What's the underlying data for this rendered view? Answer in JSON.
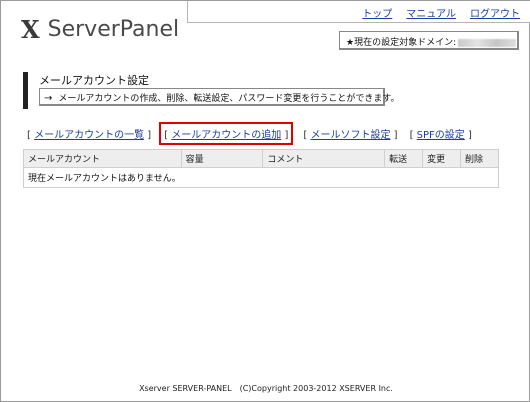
{
  "header": {
    "logo_mark": "X",
    "logo_text": "ServerPanel",
    "nav": [
      "トップ",
      "マニュアル",
      "ログアウト"
    ],
    "target_label": "★現在の設定対象ドメイン:"
  },
  "section": {
    "title": "メールアカウント設定",
    "arrow": "→",
    "description": "メールアカウントの作成、削除、転送設定、パスワード変更を行うことができます。"
  },
  "subnav": {
    "items": [
      {
        "label": "メールアカウントの一覧",
        "highlighted": false
      },
      {
        "label": "メールアカウントの追加",
        "highlighted": true
      },
      {
        "label": "メールソフト設定",
        "highlighted": false
      },
      {
        "label": "SPFの設定",
        "highlighted": false
      }
    ]
  },
  "table": {
    "columns": [
      "メールアカウント",
      "容量",
      "コメント",
      "転送",
      "変更",
      "削除"
    ],
    "empty_message": "現在メールアカウントはありません。"
  },
  "footer": {
    "text": "Xserver SERVER-PANEL　(C)Copyright 2003-2012 XSERVER Inc."
  },
  "colors": {
    "link": "#1a3fa0",
    "highlight_border": "#e00000",
    "table_header_bg": "#eeeeee"
  }
}
